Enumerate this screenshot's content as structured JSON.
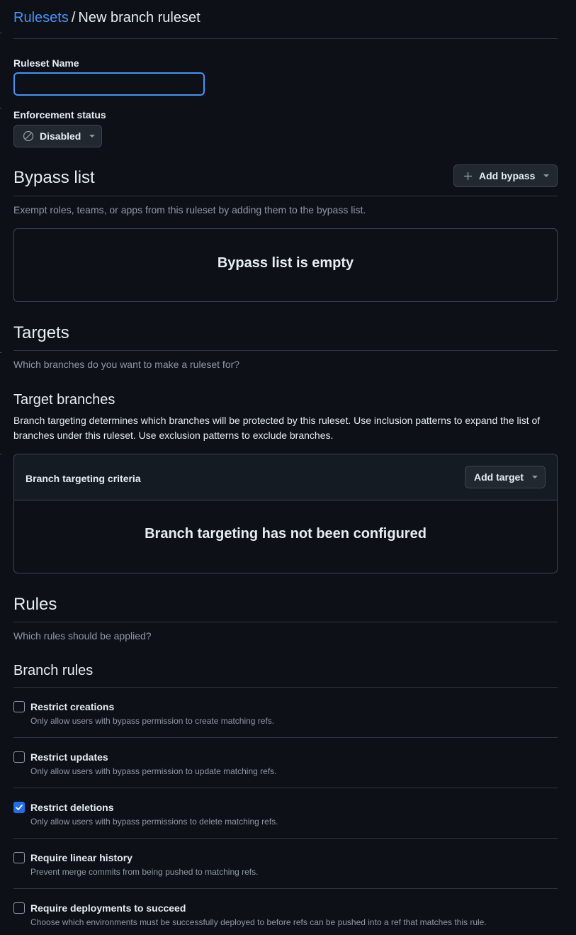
{
  "breadcrumb": {
    "parent": "Rulesets",
    "separator": "/",
    "current": "New branch ruleset"
  },
  "ruleset_name": {
    "label": "Ruleset Name",
    "value": "",
    "placeholder": ""
  },
  "enforcement": {
    "label": "Enforcement status",
    "value": "Disabled",
    "icon": "circle-slash-icon"
  },
  "bypass": {
    "title": "Bypass list",
    "add_label": "Add bypass",
    "description": "Exempt roles, teams, or apps from this ruleset by adding them to the bypass list.",
    "empty_message": "Bypass list is empty"
  },
  "targets": {
    "title": "Targets",
    "description": "Which branches do you want to make a ruleset for?",
    "branches_title": "Target branches",
    "branches_description": "Branch targeting determines which branches will be protected by this ruleset. Use inclusion patterns to expand the list of branches under this ruleset. Use exclusion patterns to exclude branches.",
    "criteria_header": "Branch targeting criteria",
    "add_target_label": "Add target",
    "empty_message": "Branch targeting has not been configured"
  },
  "rules": {
    "title": "Rules",
    "description": "Which rules should be applied?",
    "branch_rules_title": "Branch rules",
    "items": [
      {
        "title": "Restrict creations",
        "description": "Only allow users with bypass permission to create matching refs.",
        "checked": false
      },
      {
        "title": "Restrict updates",
        "description": "Only allow users with bypass permission to update matching refs.",
        "checked": false
      },
      {
        "title": "Restrict deletions",
        "description": "Only allow users with bypass permissions to delete matching refs.",
        "checked": true
      },
      {
        "title": "Require linear history",
        "description": "Prevent merge commits from being pushed to matching refs.",
        "checked": false
      },
      {
        "title": "Require deployments to succeed",
        "description": "Choose which environments must be successfully deployed to before refs can be pushed into a ref that matches this rule.",
        "checked": false
      }
    ]
  },
  "colors": {
    "background": "#0d1117",
    "accent": "#4493f8",
    "checkbox_checked": "#1f6feb",
    "border": "#3d444d",
    "muted_text": "#9198a1"
  }
}
